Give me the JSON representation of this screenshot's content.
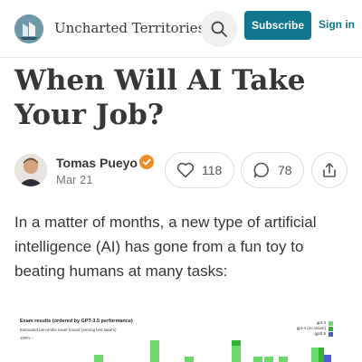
{
  "header": {
    "publication": "Uncharted Territories",
    "subscribe_label": "Subscribe",
    "signin_label": "Sign in"
  },
  "article": {
    "title": "When Will AI Take Your Job?",
    "author": "Tomas Pueyo",
    "date": "Mar 21",
    "likes": "118",
    "comments": "78",
    "body": "In a matter of months, a new type of artificial intelligence (AI) has gone from a fun toy to beating humans at many tasks:"
  },
  "figure": {
    "title": "Exam results (ordered by GPT-3.5 performance)",
    "subtitle": "Estimated percentile lower bound (among test takers)",
    "tick": "100% –",
    "legend": [
      {
        "label": "gpt-4",
        "color": "#6dd86d"
      },
      {
        "label": "gpt-4 (no vision)",
        "color": "#2fb52f"
      },
      {
        "label": "gpt3.5",
        "color": "#4a5fd6"
      }
    ]
  }
}
